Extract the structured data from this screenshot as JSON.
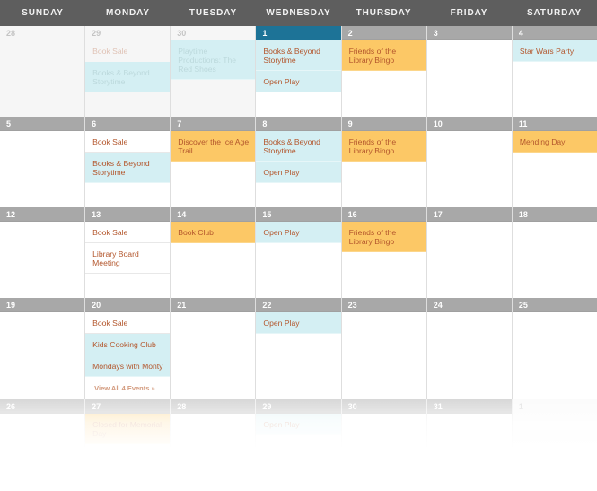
{
  "weekdays": [
    "SUNDAY",
    "MONDAY",
    "TUESDAY",
    "WEDNESDAY",
    "THURSDAY",
    "FRIDAY",
    "SATURDAY"
  ],
  "colors": {
    "header_bg": "#5e5e5e",
    "day_bar": "#a8a8a8",
    "today_bar": "#1d7397",
    "event_blue": "#d4eff3",
    "event_orange": "#fcc866",
    "event_text": "#b3562c"
  },
  "weeks": [
    {
      "days": [
        {
          "num": "28",
          "other_month": true,
          "events": []
        },
        {
          "num": "29",
          "other_month": true,
          "events": [
            {
              "title": "Book Sale",
              "style": "white"
            },
            {
              "title": "Books & Beyond Storytime",
              "style": "blue"
            }
          ]
        },
        {
          "num": "30",
          "other_month": true,
          "events": [
            {
              "title": "Playtime Productions: The Red Shoes",
              "style": "blue"
            }
          ]
        },
        {
          "num": "1",
          "today": true,
          "events": [
            {
              "title": "Books & Beyond Storytime",
              "style": "blue"
            },
            {
              "title": "Open Play",
              "style": "blue"
            }
          ]
        },
        {
          "num": "2",
          "events": [
            {
              "title": "Friends of the Library Bingo",
              "style": "orange"
            }
          ]
        },
        {
          "num": "3",
          "events": []
        },
        {
          "num": "4",
          "events": [
            {
              "title": "Star Wars Party",
              "style": "blue"
            }
          ]
        }
      ]
    },
    {
      "days": [
        {
          "num": "5",
          "events": []
        },
        {
          "num": "6",
          "events": [
            {
              "title": "Book Sale",
              "style": "white"
            },
            {
              "title": "Books & Beyond Storytime",
              "style": "blue"
            }
          ]
        },
        {
          "num": "7",
          "events": [
            {
              "title": "Discover the Ice Age Trail",
              "style": "orange"
            }
          ]
        },
        {
          "num": "8",
          "events": [
            {
              "title": "Books & Beyond Storytime",
              "style": "blue"
            },
            {
              "title": "Open Play",
              "style": "blue"
            }
          ]
        },
        {
          "num": "9",
          "events": [
            {
              "title": "Friends of the Library Bingo",
              "style": "orange"
            }
          ]
        },
        {
          "num": "10",
          "events": []
        },
        {
          "num": "11",
          "events": [
            {
              "title": "Mending Day",
              "style": "orange"
            }
          ]
        }
      ]
    },
    {
      "days": [
        {
          "num": "12",
          "events": []
        },
        {
          "num": "13",
          "events": [
            {
              "title": "Book Sale",
              "style": "white"
            },
            {
              "title": "Library Board Meeting",
              "style": "white"
            }
          ]
        },
        {
          "num": "14",
          "events": [
            {
              "title": "Book Club",
              "style": "orange"
            }
          ]
        },
        {
          "num": "15",
          "events": [
            {
              "title": "Open Play",
              "style": "blue"
            }
          ]
        },
        {
          "num": "16",
          "events": [
            {
              "title": "Friends of the Library Bingo",
              "style": "orange"
            }
          ]
        },
        {
          "num": "17",
          "events": []
        },
        {
          "num": "18",
          "events": []
        }
      ]
    },
    {
      "days": [
        {
          "num": "19",
          "events": []
        },
        {
          "num": "20",
          "events": [
            {
              "title": "Book Sale",
              "style": "white"
            },
            {
              "title": "Kids Cooking Club",
              "style": "blue"
            },
            {
              "title": "Mondays with Monty",
              "style": "blue"
            }
          ],
          "view_all": "View All 4 Events »"
        },
        {
          "num": "21",
          "events": []
        },
        {
          "num": "22",
          "events": [
            {
              "title": "Open Play",
              "style": "blue"
            }
          ]
        },
        {
          "num": "23",
          "events": []
        },
        {
          "num": "24",
          "events": []
        },
        {
          "num": "25",
          "events": []
        }
      ]
    },
    {
      "days": [
        {
          "num": "26",
          "events": []
        },
        {
          "num": "27",
          "events": [
            {
              "title": "Closed for Memorial Day",
              "style": "orange"
            }
          ]
        },
        {
          "num": "28",
          "events": []
        },
        {
          "num": "29",
          "events": [
            {
              "title": "Open Play",
              "style": "blue"
            }
          ]
        },
        {
          "num": "30",
          "events": []
        },
        {
          "num": "31",
          "events": []
        },
        {
          "num": "1",
          "other_month": true,
          "events": []
        }
      ]
    }
  ]
}
